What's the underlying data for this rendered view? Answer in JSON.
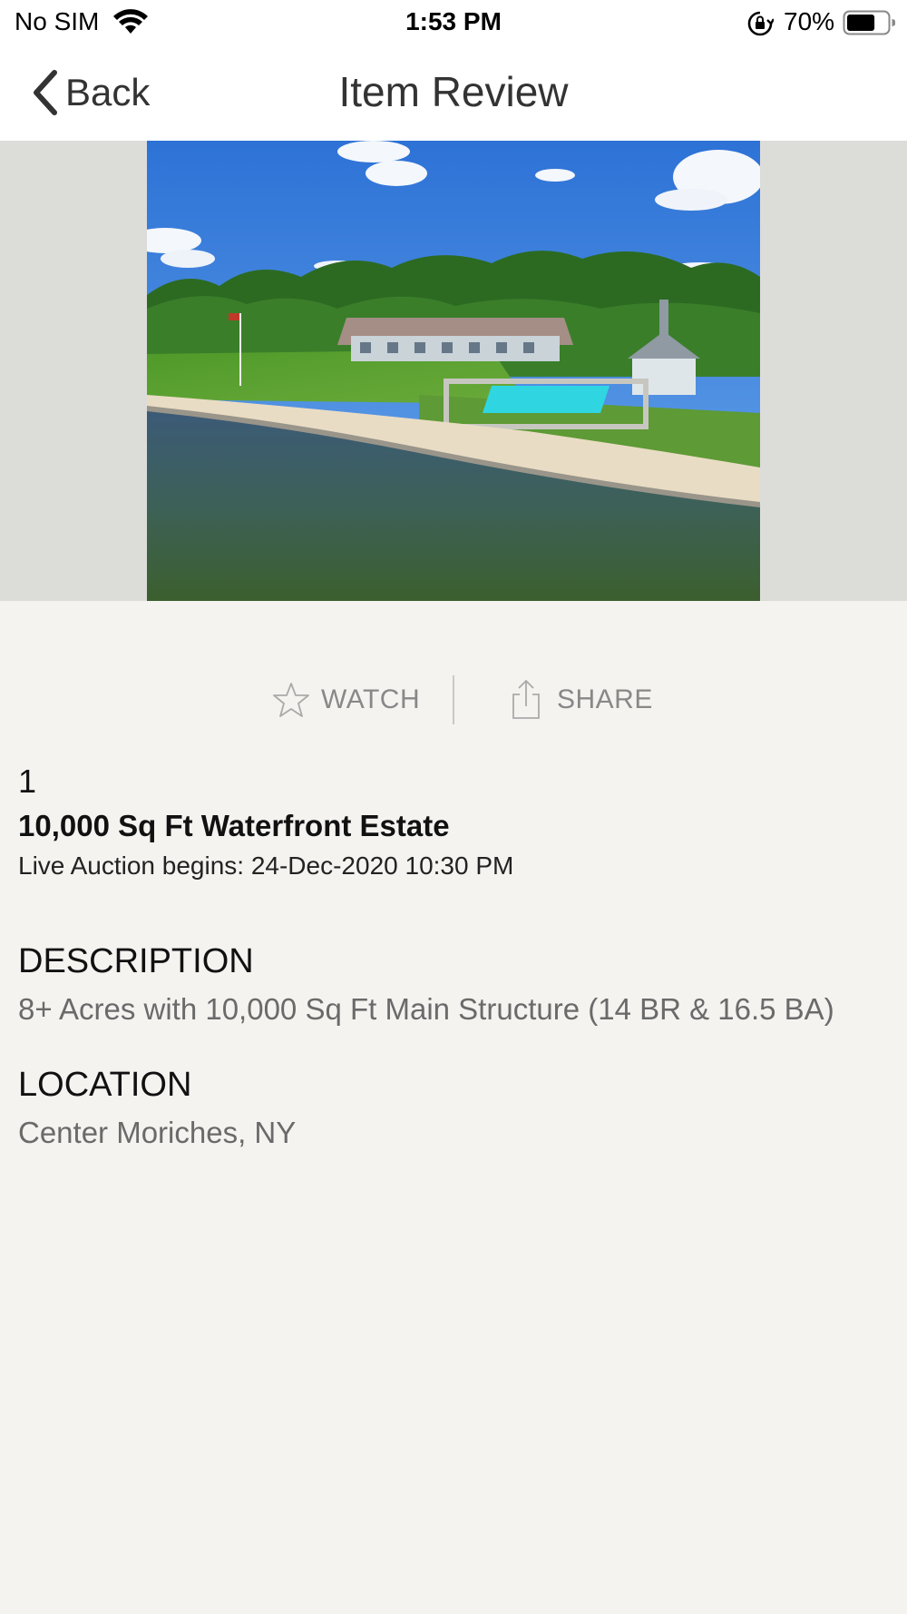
{
  "status_bar": {
    "carrier": "No SIM",
    "time": "1:53 PM",
    "battery_percent": "70%",
    "battery_level": 0.7,
    "icons": [
      "wifi-icon",
      "orientation-lock-icon",
      "battery-icon"
    ]
  },
  "nav": {
    "back_label": "Back",
    "title": "Item Review",
    "icons": [
      "chevron-left-icon"
    ]
  },
  "hero": {
    "image_subject": "aerial view of waterfront estate with pool and beach"
  },
  "actions": {
    "watch_label": "WATCH",
    "share_label": "SHARE",
    "icons": [
      "star-outline-icon",
      "share-icon"
    ]
  },
  "item": {
    "lot_number": "1",
    "title": "10,000 Sq Ft Waterfront Estate",
    "auction_time": "Live Auction begins: 24-Dec-2020 10:30 PM"
  },
  "description": {
    "heading": "DESCRIPTION",
    "text": "8+ Acres with 10,000 Sq Ft Main Structure (14 BR & 16.5 BA)"
  },
  "location": {
    "heading": "LOCATION",
    "text": "Center Moriches, NY"
  },
  "colors": {
    "background": "#f4f3f0",
    "header_background": "#ffffff",
    "hero_background": "#dcdcd9",
    "action_text": "#888888",
    "body_text": "#6a6a6a"
  }
}
